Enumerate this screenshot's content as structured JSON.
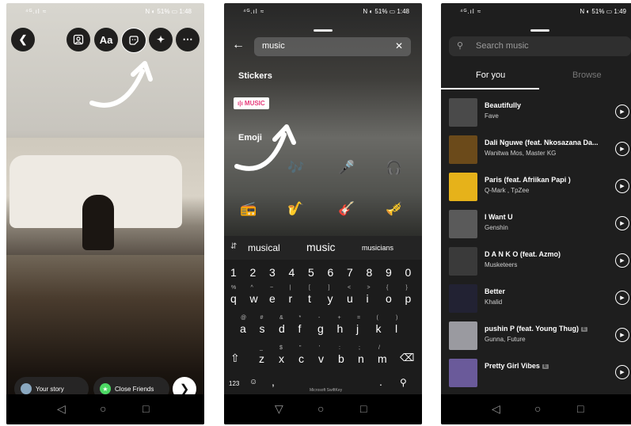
{
  "status": {
    "p1": {
      "left": "⁴ᴳ.ıl ≈",
      "right": "N ◐ 51% ▭ 1:48"
    },
    "p2": {
      "left": "⁴ᴳ.ıl ≈",
      "right": "N ◐ 51% ▭ 1:48"
    },
    "p3": {
      "left": "⁴ᴳ.ıl ≈",
      "right": "N ◐ 51% ▭ 1:49"
    }
  },
  "story_editor": {
    "toolbar": {
      "text_label": "Aa"
    },
    "share": {
      "your_story": "Your story",
      "close_friends": "Close Friends"
    },
    "colors": {
      "close_friends": "#4cd964"
    }
  },
  "sticker_search": {
    "query": "music",
    "sections": {
      "stickers": "Stickers",
      "emoji": "Emoji"
    },
    "music_sticker_label": "ı|ı MUSIC",
    "emoji": [
      "🎵",
      "🎶",
      "🎤",
      "🎧",
      "📻",
      "🎷",
      "🎸",
      "🎺"
    ],
    "suggestions": [
      "musical",
      "music",
      "musicians"
    ],
    "keyboard": {
      "numbers": [
        "1",
        "2",
        "3",
        "4",
        "5",
        "6",
        "7",
        "8",
        "9",
        "0"
      ],
      "row1": [
        "q",
        "w",
        "e",
        "r",
        "t",
        "y",
        "u",
        "i",
        "o",
        "p"
      ],
      "row1_alt": [
        "%",
        "^",
        "~",
        "|",
        "[",
        "]",
        "<",
        ">",
        "{",
        "}"
      ],
      "row2": [
        "a",
        "s",
        "d",
        "f",
        "g",
        "h",
        "j",
        "k",
        "l"
      ],
      "row2_alt": [
        "@",
        "#",
        "&",
        "*",
        "-",
        "+",
        "=",
        "(",
        ")"
      ],
      "row3": [
        "z",
        "x",
        "c",
        "v",
        "b",
        "n",
        "m"
      ],
      "row3_alt": [
        "_",
        "$",
        "\"",
        "'",
        ":",
        ";",
        "/"
      ],
      "symbols_key": "123",
      "space_label": "Microsoft SwiftKey",
      "comma_key": ",",
      "period_key": "."
    }
  },
  "music_picker": {
    "search_placeholder": "Search music",
    "tabs": [
      "For you",
      "Browse"
    ],
    "songs": [
      {
        "title": "Beautifully",
        "artist": "Fave",
        "explicit": false,
        "color": "#4a4a4a"
      },
      {
        "title": "Dali Nguwe (feat. Nkosazana Da...",
        "artist": "Wanitwa Mos, Master KG",
        "explicit": false,
        "color": "#6b4a1a"
      },
      {
        "title": "Paris (feat. Afriikan Papi )",
        "artist": "Q-Mark , TpZee",
        "explicit": false,
        "color": "#e6b21a"
      },
      {
        "title": "I Want U",
        "artist": "Genshin",
        "explicit": false,
        "color": "#5a5a5a"
      },
      {
        "title": "D A N K O (feat. Azmo)",
        "artist": "Musketeers",
        "explicit": false,
        "color": "#3a3a3a"
      },
      {
        "title": "Better",
        "artist": "Khalid",
        "explicit": false,
        "color": "#222233"
      },
      {
        "title": "pushin P (feat. Young Thug)",
        "artist": "Gunna, Future",
        "explicit": true,
        "color": "#9a9aa0"
      },
      {
        "title": "Pretty Girl Vibes",
        "artist": "",
        "explicit": true,
        "color": "#6a5a9a"
      }
    ],
    "explicit_badge": "E"
  }
}
